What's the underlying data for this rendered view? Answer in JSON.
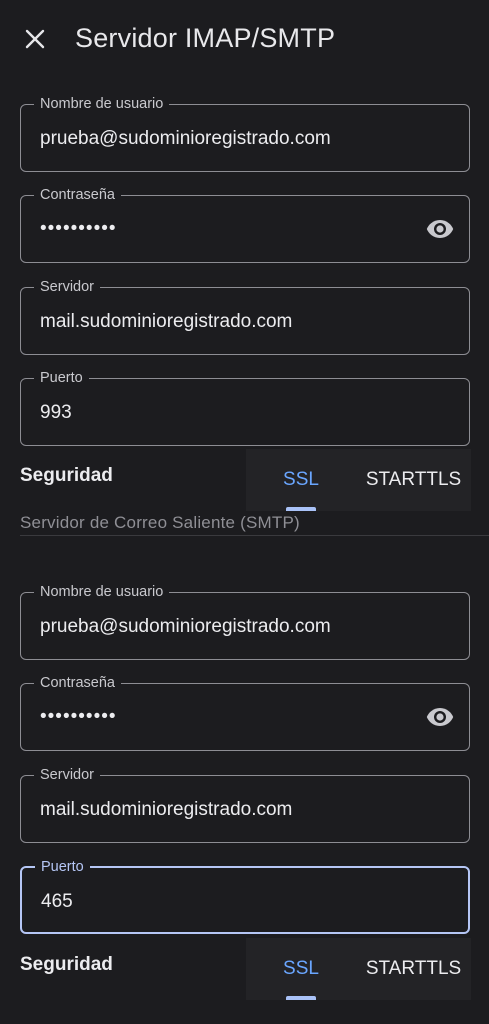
{
  "header": {
    "title": "Servidor IMAP/SMTP",
    "close_icon": "close-icon"
  },
  "imap": {
    "username": {
      "label": "Nombre de usuario",
      "value": "prueba@sudominioregistrado.com"
    },
    "password": {
      "label": "Contraseña",
      "value": "••••••••••",
      "toggle_icon": "eye-icon"
    },
    "server": {
      "label": "Servidor",
      "value": "mail.sudominioregistrado.com"
    },
    "port": {
      "label": "Puerto",
      "value": "993"
    },
    "security": {
      "label": "Seguridad",
      "options": [
        "SSL",
        "STARTTLS"
      ],
      "selected": "SSL"
    }
  },
  "smtp": {
    "section_title": "Servidor de Correo Saliente (SMTP)",
    "username": {
      "label": "Nombre de usuario",
      "value": "prueba@sudominioregistrado.com"
    },
    "password": {
      "label": "Contraseña",
      "value": "••••••••••",
      "toggle_icon": "eye-icon"
    },
    "server": {
      "label": "Servidor",
      "value": "mail.sudominioregistrado.com"
    },
    "port": {
      "label": "Puerto",
      "value": "465",
      "focused": true
    },
    "security": {
      "label": "Seguridad",
      "options": [
        "SSL",
        "STARTTLS"
      ],
      "selected": "SSL"
    }
  },
  "colors": {
    "background": "#1c1c1f",
    "accent": "#6aa6ff",
    "focus_border": "#b5c6f5",
    "outline": "#8d8d93"
  }
}
